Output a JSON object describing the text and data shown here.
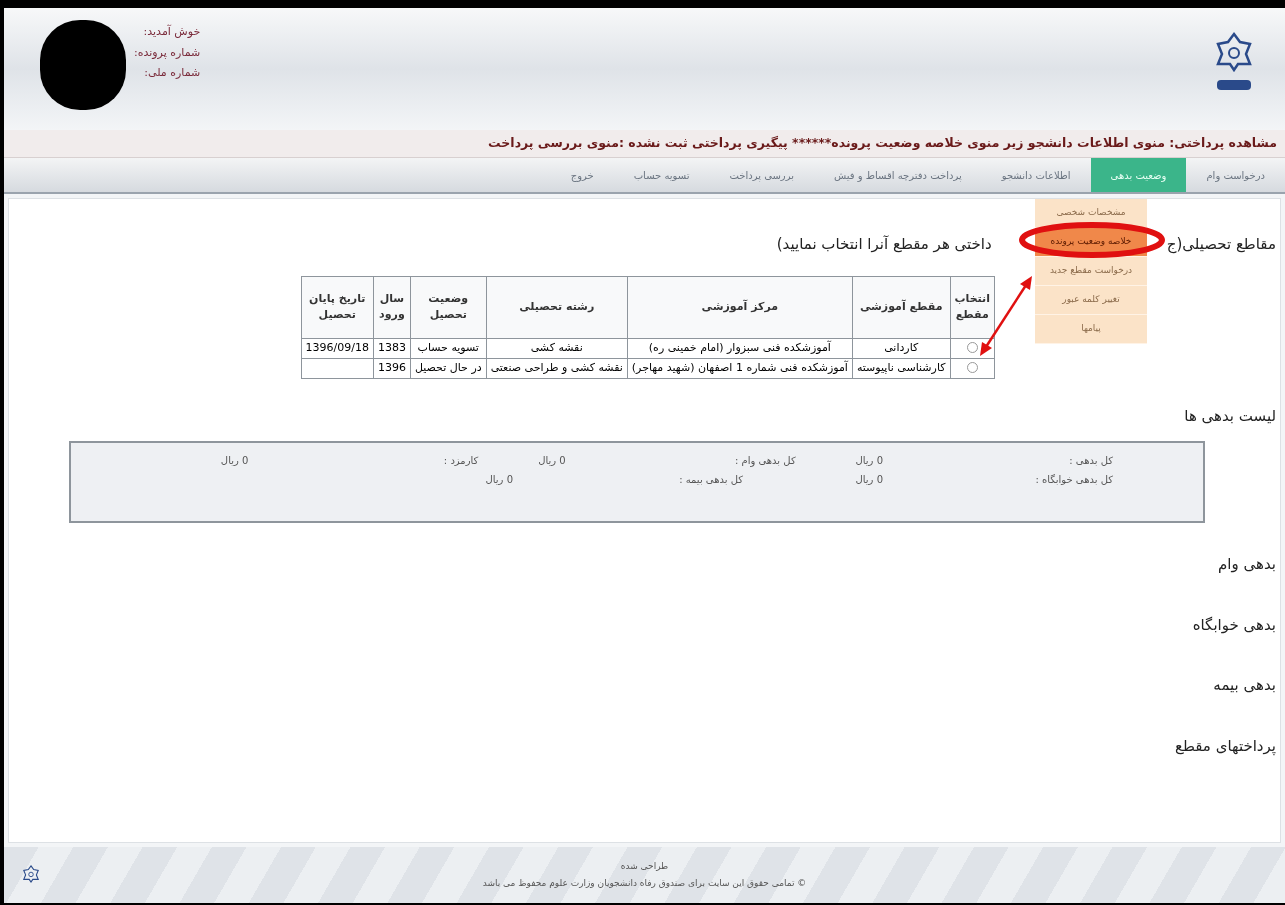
{
  "header": {
    "labels": [
      "خوش آمدید:",
      "شماره پرونده:",
      "شماره ملی:"
    ]
  },
  "notice": "مشاهده پرداختی: منوی اطلاعات دانشجو زیر منوی خلاصه وضعیت پرونده****** پیگیری پرداختی ثبت نشده :منوی بررسی پرداخت",
  "menu": [
    {
      "label": "درخواست وام",
      "selected": false
    },
    {
      "label": "وضعیت بدهی",
      "selected": true
    },
    {
      "label": "اطلاعات دانشجو",
      "selected": false
    },
    {
      "label": "پرداخت دفترچه اقساط و فیش",
      "selected": false
    },
    {
      "label": "بررسی پرداخت",
      "selected": false
    },
    {
      "label": "تسویه حساب",
      "selected": false
    },
    {
      "label": "خروج",
      "selected": false
    }
  ],
  "dropdown": [
    {
      "label": "مشخصات شخصی",
      "selected": false
    },
    {
      "label": "خلاصه وضعیت پرونده",
      "selected": true
    },
    {
      "label": "درخواست مقطع جدید",
      "selected": false
    },
    {
      "label": "تغییر کلمه عبور",
      "selected": false
    },
    {
      "label": "پیامها",
      "selected": false
    }
  ],
  "heading": {
    "visible_start": "مقاطع تحصیلی(ج",
    "visible_end": "داختی هر مقطع آنرا انتخاب نمایید)"
  },
  "table": {
    "columns": [
      "انتخاب مقطع",
      "مقطع آموزشی",
      "مرکز آموزشی",
      "رشته تحصیلی",
      "وضعیت تحصیل",
      "سال ورود",
      "تاریخ پایان تحصیل"
    ],
    "rows": [
      {
        "selected": false,
        "cells": [
          "",
          "کاردانی",
          "آموزشکده فنی سبزوار (امام خمینی ره)",
          "نقشه کشی",
          "تسویه حساب",
          "1383",
          "1396/09/18"
        ]
      },
      {
        "selected": false,
        "cells": [
          "",
          "کارشناسی ناپیوسته",
          "آموزشکده فنی شماره 1 اصفهان (شهید مهاجر)",
          "نقشه کشی و طراحی صنعتی",
          "در حال تحصیل",
          "1396",
          ""
        ]
      }
    ]
  },
  "debts": {
    "title": "لیست بدهی ها",
    "rows": [
      [
        {
          "label": "کل بدهی :",
          "value": "0 ریال"
        },
        {
          "label": "کل بدهی وام :",
          "value": "0 ریال"
        },
        {
          "label": "کارمزد :",
          "value": "0 ریال"
        }
      ],
      [
        {
          "label": "کل بدهی خوابگاه :",
          "value": "0 ریال"
        },
        {
          "label": "کل بدهی بیمه :",
          "value": "0 ریال"
        }
      ]
    ]
  },
  "sections": [
    "بدهی وام",
    "بدهی خوابگاه",
    "بدهی بیمه",
    "پرداختهای مقطع"
  ],
  "footer": [
    "طراحی شده",
    "© تمامی حقوق این سایت برای صندوق رفاه دانشجویان وزارت علوم محفوظ می باشد"
  ]
}
